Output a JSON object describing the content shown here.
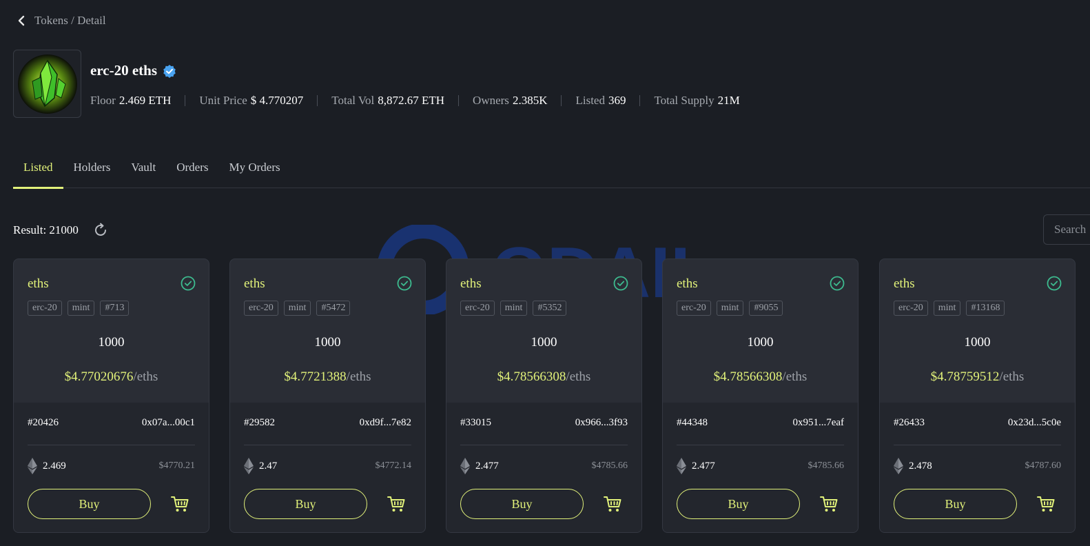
{
  "breadcrumb": "Tokens / Detail",
  "token": {
    "name": "erc-20 eths",
    "stats": [
      {
        "label": "Floor",
        "value": "2.469 ETH"
      },
      {
        "label": "Unit Price",
        "value": "$ 4.770207"
      },
      {
        "label": "Total Vol",
        "value": "8,872.67 ETH"
      },
      {
        "label": "Owners",
        "value": "2.385K"
      },
      {
        "label": "Listed",
        "value": "369"
      },
      {
        "label": "Total Supply",
        "value": "21M"
      }
    ]
  },
  "tabs": [
    {
      "label": "Listed",
      "active": true
    },
    {
      "label": "Holders"
    },
    {
      "label": "Vault"
    },
    {
      "label": "Orders"
    },
    {
      "label": "My Orders"
    }
  ],
  "result": "Result: 21000",
  "search_placeholder": "Search",
  "watermark_text": "ODAILY",
  "colors": {
    "accent": "#e2f27a",
    "check": "#3dbb8f",
    "background": "#1b1e24",
    "card": "#2a2d35"
  },
  "cards": [
    {
      "name": "eths",
      "tags": [
        "erc-20",
        "mint",
        "#713"
      ],
      "amount": "1000",
      "price": "$4.77020676",
      "unit": "/eths",
      "id": "#20426",
      "address": "0x07a...00c1",
      "eth": "2.469",
      "usd": "$4770.21",
      "buy": "Buy"
    },
    {
      "name": "eths",
      "tags": [
        "erc-20",
        "mint",
        "#5472"
      ],
      "amount": "1000",
      "price": "$4.7721388",
      "unit": "/eths",
      "id": "#29582",
      "address": "0xd9f...7e82",
      "eth": "2.47",
      "usd": "$4772.14",
      "buy": "Buy"
    },
    {
      "name": "eths",
      "tags": [
        "erc-20",
        "mint",
        "#5352"
      ],
      "amount": "1000",
      "price": "$4.78566308",
      "unit": "/eths",
      "id": "#33015",
      "address": "0x966...3f93",
      "eth": "2.477",
      "usd": "$4785.66",
      "buy": "Buy"
    },
    {
      "name": "eths",
      "tags": [
        "erc-20",
        "mint",
        "#9055"
      ],
      "amount": "1000",
      "price": "$4.78566308",
      "unit": "/eths",
      "id": "#44348",
      "address": "0x951...7eaf",
      "eth": "2.477",
      "usd": "$4785.66",
      "buy": "Buy"
    },
    {
      "name": "eths",
      "tags": [
        "erc-20",
        "mint",
        "#13168"
      ],
      "amount": "1000",
      "price": "$4.78759512",
      "unit": "/eths",
      "id": "#26433",
      "address": "0x23d...5c0e",
      "eth": "2.478",
      "usd": "$4787.60",
      "buy": "Buy"
    }
  ]
}
